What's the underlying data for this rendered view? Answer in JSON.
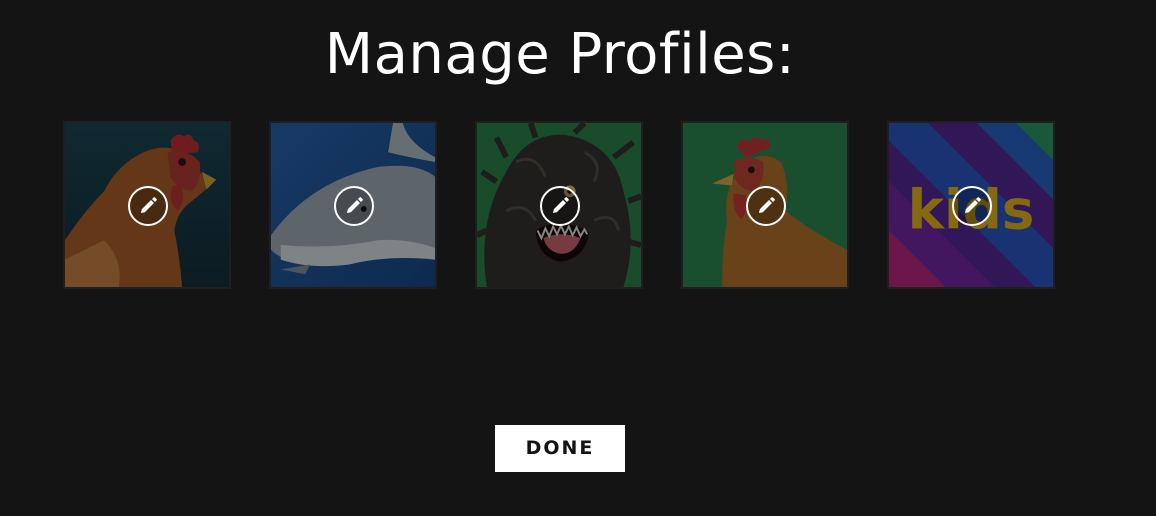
{
  "page": {
    "title": "Manage Profiles:"
  },
  "profiles": [
    {
      "avatar": "chicken-avatar",
      "background": "#1d3b4a",
      "edit_icon": "pencil-icon"
    },
    {
      "avatar": "shark-avatar",
      "background": "#1f5ea6",
      "edit_icon": "pencil-icon"
    },
    {
      "avatar": "furry-monster-avatar",
      "background": "#2f8a4e",
      "edit_icon": "pencil-icon"
    },
    {
      "avatar": "chicken-avatar",
      "background": "#2f9056",
      "edit_icon": "pencil-icon"
    },
    {
      "avatar": "kids-avatar",
      "background": "#5a2a9a",
      "label": "kids",
      "edit_icon": "pencil-icon"
    }
  ],
  "actions": {
    "done_label": "DONE"
  }
}
